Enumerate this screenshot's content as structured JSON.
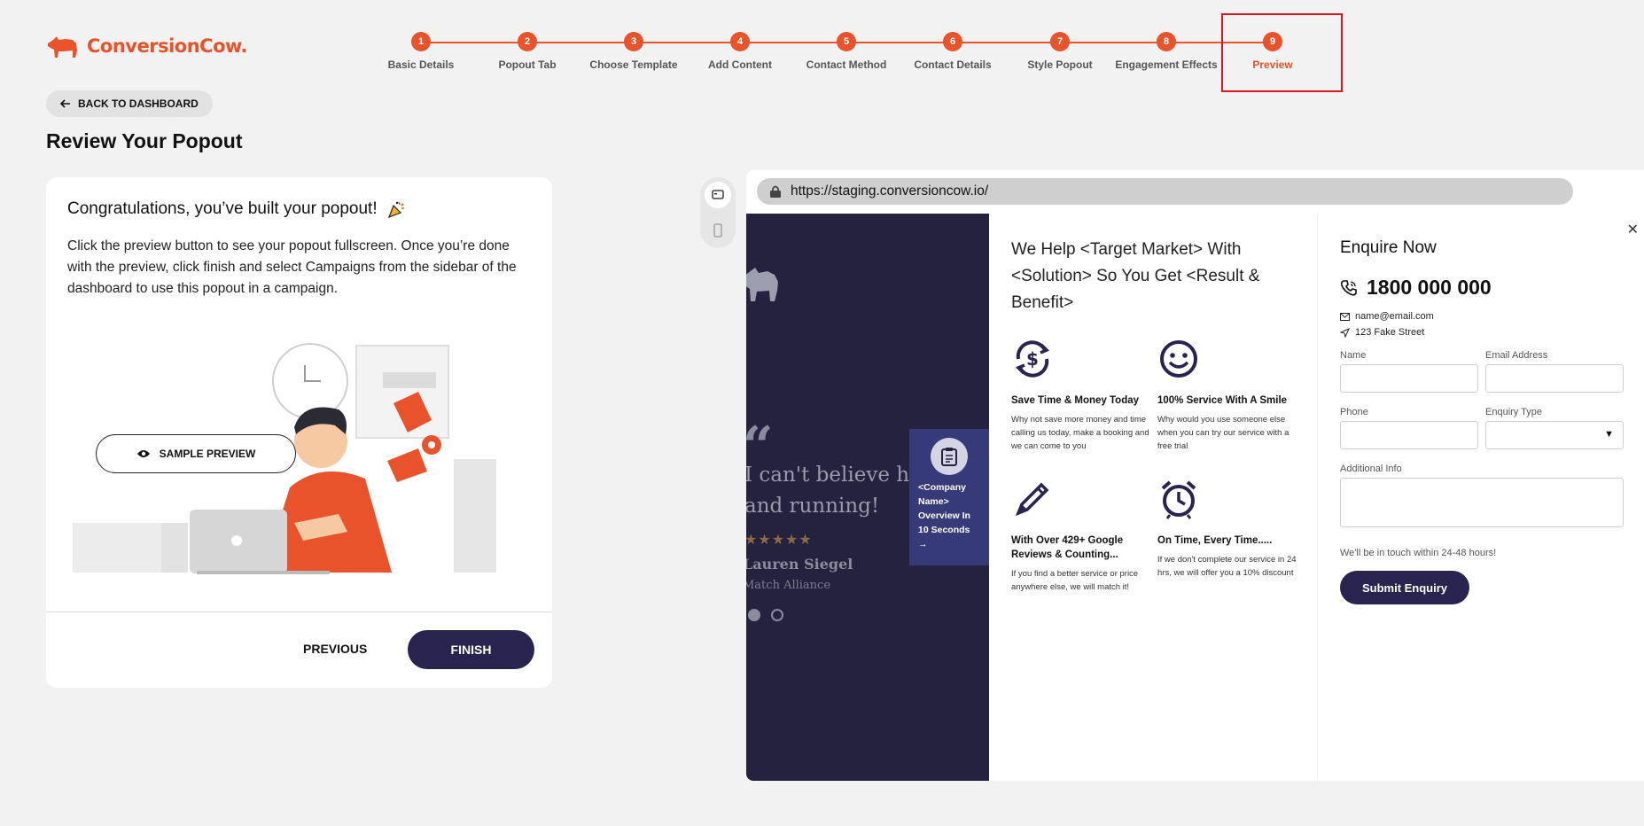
{
  "brand": {
    "name": "ConversionCow.",
    "color": "#e8532b"
  },
  "stepper": {
    "steps": [
      {
        "num": "1",
        "label": "Basic Details"
      },
      {
        "num": "2",
        "label": "Popout Tab"
      },
      {
        "num": "3",
        "label": "Choose Template"
      },
      {
        "num": "4",
        "label": "Add Content"
      },
      {
        "num": "5",
        "label": "Contact Method"
      },
      {
        "num": "6",
        "label": "Contact Details"
      },
      {
        "num": "7",
        "label": "Style Popout"
      },
      {
        "num": "8",
        "label": "Engagement Effects"
      },
      {
        "num": "9",
        "label": "Preview"
      }
    ],
    "active_step": "9"
  },
  "back_button": {
    "label": "BACK TO DASHBOARD",
    "icon": "arrow-left-icon"
  },
  "page_title": "Review Your Popout",
  "card": {
    "heading": "Congratulations, you’ve built your popout!",
    "heading_icon": "party-popper-icon",
    "body": "Click the preview button to see your popout fullscreen. Once you’re done with the preview, click finish and select Campaigns from the sidebar of the dashboard to use this popout in a campaign.",
    "sample_preview_label": "SAMPLE PREVIEW",
    "previous_label": "PREVIOUS",
    "finish_label": "FINISH"
  },
  "browser": {
    "url": "https://staging.conversioncow.io/"
  },
  "preview": {
    "testimonial": {
      "quote_line1": "I can't believe how",
      "quote_line2": "and running!",
      "stars": "★★★★★",
      "name": "Lauren Siegel",
      "company": "Match Alliance"
    },
    "tab": {
      "text": "<Company Name> Overview In 10 Seconds →"
    },
    "headline": "We Help <Target Market> With <Solution> So You Get <Result & Benefit>",
    "features": [
      {
        "icon": "dollar-cycle-icon",
        "title": "Save Time & Money Today",
        "desc": "Why not save more money and time calling us today, make a booking and we can come to you"
      },
      {
        "icon": "smile-icon",
        "title": "100% Service With A Smile",
        "desc": "Why would you use someone else when you can try our service with a free trial"
      },
      {
        "icon": "pencil-icon",
        "title": "With Over 429+ Google Reviews & Counting...",
        "desc": "If you find a better service or price anywhere else, we will match it!"
      },
      {
        "icon": "alarm-clock-icon",
        "title": "On Time, Every Time.....",
        "desc": "If we don't complete our service in 24 hrs, we will offer you a 10% discount"
      }
    ],
    "form": {
      "title": "Enquire Now",
      "phone": "1800 000 000",
      "email": "name@email.com",
      "address": "123 Fake Street",
      "name_label": "Name",
      "email_label": "Email Address",
      "phone_label": "Phone",
      "enquiry_type_label": "Enquiry Type",
      "additional_label": "Additional Info",
      "note": "We'll be in touch within 24-48 hours!",
      "submit_label": "Submit Enquiry"
    }
  }
}
